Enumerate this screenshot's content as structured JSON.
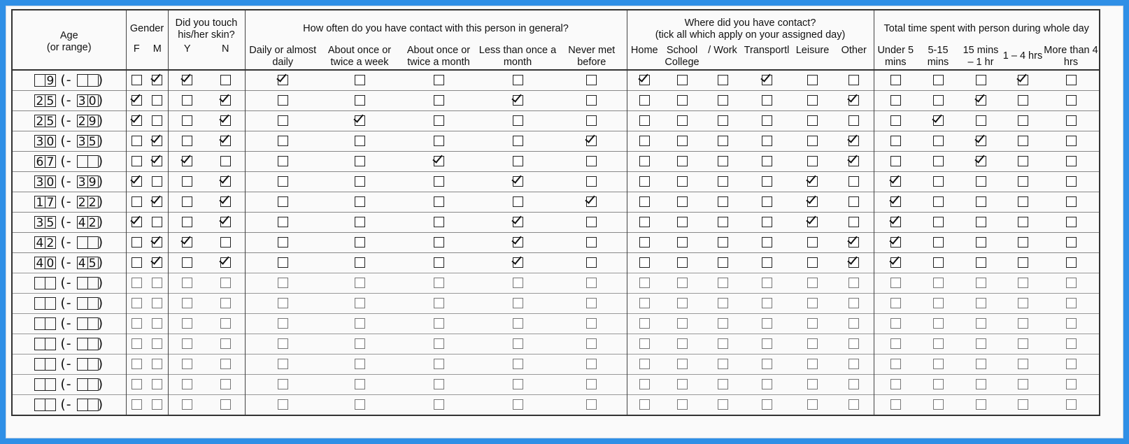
{
  "headers": {
    "age": "Age",
    "age_sub": "(or range)",
    "gender": "Gender",
    "gender_f": "F",
    "gender_m": "M",
    "touch": "Did you touch his/her skin?",
    "touch_y": "Y",
    "touch_n": "N",
    "often": "How often do you have contact with this person in general?",
    "often_opts": [
      "Daily or almost daily",
      "About once or twice a week",
      "About once or twice a month",
      "Less than once a month",
      "Never met before"
    ],
    "where": "Where did you have contact?",
    "where_sub": "(tick all which apply on your assigned day)",
    "where_opts": [
      "Home",
      "School",
      "/",
      "Work",
      "Transportl",
      "Leisure",
      "Other"
    ],
    "where_college": "College",
    "total": "Total time spent with person during whole day",
    "total_opts": [
      "Under 5 mins",
      "5-15 mins",
      "15 mins – 1 hr",
      "1 – 4 hrs",
      "More than 4 hrs"
    ]
  },
  "rows": [
    {
      "age": [
        "",
        "9",
        "",
        ""
      ],
      "gender": "M",
      "touch": "Y",
      "often": 0,
      "where": [
        0,
        3
      ],
      "time": 3
    },
    {
      "age": [
        "2",
        "5",
        "3",
        "0"
      ],
      "gender": "F",
      "touch": "N",
      "often": 3,
      "where": [
        5
      ],
      "time": 2
    },
    {
      "age": [
        "2",
        "5",
        "2",
        "9"
      ],
      "gender": "F",
      "touch": "N",
      "often": 1,
      "where": [],
      "time": 1
    },
    {
      "age": [
        "3",
        "0",
        "3",
        "5"
      ],
      "gender": "M",
      "touch": "N",
      "often": 4,
      "where": [
        5
      ],
      "time": 2
    },
    {
      "age": [
        "6",
        "7",
        "",
        ""
      ],
      "gender": "M",
      "touch": "Y",
      "often": 2,
      "where": [
        5
      ],
      "time": 2
    },
    {
      "age": [
        "3",
        "0",
        "3",
        "9"
      ],
      "gender": "F",
      "touch": "N",
      "often": 3,
      "where": [
        4
      ],
      "time": 0
    },
    {
      "age": [
        "1",
        "7",
        "2",
        "2"
      ],
      "gender": "M",
      "touch": "N",
      "often": 4,
      "where": [
        4
      ],
      "time": 0
    },
    {
      "age": [
        "3",
        "5",
        "4",
        "2"
      ],
      "gender": "F",
      "touch": "N",
      "often": 3,
      "where": [
        4
      ],
      "time": 0
    },
    {
      "age": [
        "4",
        "2",
        "",
        ""
      ],
      "gender": "M",
      "touch": "Y",
      "often": 3,
      "where": [
        5
      ],
      "time": 0
    },
    {
      "age": [
        "4",
        "0",
        "4",
        "5"
      ],
      "gender": "M",
      "touch": "N",
      "often": 3,
      "where": [
        5
      ],
      "time": 0
    },
    {
      "age": [
        "",
        "",
        "",
        ""
      ],
      "gender": "",
      "touch": "",
      "often": -1,
      "where": [],
      "time": -1
    },
    {
      "age": [
        "",
        "",
        "",
        ""
      ],
      "gender": "",
      "touch": "",
      "often": -1,
      "where": [],
      "time": -1
    },
    {
      "age": [
        "",
        "",
        "",
        ""
      ],
      "gender": "",
      "touch": "",
      "often": -1,
      "where": [],
      "time": -1
    },
    {
      "age": [
        "",
        "",
        "",
        ""
      ],
      "gender": "",
      "touch": "",
      "often": -1,
      "where": [],
      "time": -1
    },
    {
      "age": [
        "",
        "",
        "",
        ""
      ],
      "gender": "",
      "touch": "",
      "often": -1,
      "where": [],
      "time": -1
    },
    {
      "age": [
        "",
        "",
        "",
        ""
      ],
      "gender": "",
      "touch": "",
      "often": -1,
      "where": [],
      "time": -1
    },
    {
      "age": [
        "",
        "",
        "",
        ""
      ],
      "gender": "",
      "touch": "",
      "often": -1,
      "where": [],
      "time": -1
    }
  ]
}
